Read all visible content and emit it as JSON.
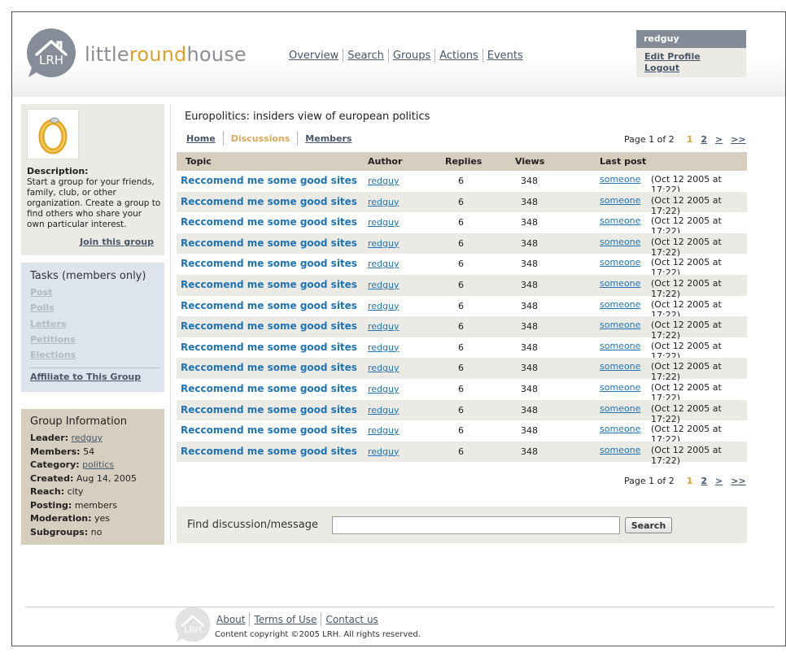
{
  "brand": {
    "logo_initials": "LRH",
    "name_part1": "little",
    "name_part2": "round",
    "name_part3": "house"
  },
  "topnav": [
    "Overview",
    "Search",
    "Groups",
    "Actions",
    "Events"
  ],
  "user": {
    "name": "redguy",
    "edit_profile": "Edit Profile",
    "logout": "Logout"
  },
  "group": {
    "title": "Europolitics: insiders view of european politics",
    "description_label": "Description:",
    "description": "Start a group for your friends, family, club, or other organization. Create a group to find others who share your own particular interest.",
    "join": "Join this group"
  },
  "tasks": {
    "title": "Tasks",
    "subtitle": "(members only)",
    "items": [
      "Post",
      "Polls",
      "Letters",
      "Petitions",
      "Elections"
    ],
    "affiliate": "Affiliate to This Group"
  },
  "info": {
    "title": "Group Information",
    "rows": [
      {
        "label": "Leader:",
        "value": "redguy",
        "link": true
      },
      {
        "label": "Members:",
        "value": "54",
        "link": false
      },
      {
        "label": "Category:",
        "value": "politics",
        "link": true
      },
      {
        "label": "Created:",
        "value": "Aug 14, 2005",
        "link": false
      },
      {
        "label": "Reach:",
        "value": "city",
        "link": false
      },
      {
        "label": "Posting:",
        "value": "members",
        "link": false
      },
      {
        "label": "Moderation:",
        "value": "yes",
        "link": false
      },
      {
        "label": "Subgroups:",
        "value": "no",
        "link": false
      }
    ]
  },
  "subnav": [
    "Home",
    "Discussions",
    "Members"
  ],
  "pager": {
    "label": "Page 1 of 2",
    "pages": [
      "1",
      "2"
    ],
    "next": ">",
    "last": ">>"
  },
  "table": {
    "headers": [
      "Topic",
      "Author",
      "Replies",
      "Views",
      "Last post"
    ],
    "rows": [
      {
        "topic": "Reccomend me some good sites",
        "author": "redguy",
        "replies": "6",
        "views": "348",
        "last_user": "someone",
        "last_date": "(Oct 12 2005 at 17:22)"
      },
      {
        "topic": "Reccomend me some good sites",
        "author": "redguy",
        "replies": "6",
        "views": "348",
        "last_user": "someone",
        "last_date": "(Oct 12 2005 at 17:22)"
      },
      {
        "topic": "Reccomend me some good sites",
        "author": "redguy",
        "replies": "6",
        "views": "348",
        "last_user": "someone",
        "last_date": "(Oct 12 2005 at 17:22)"
      },
      {
        "topic": "Reccomend me some good sites",
        "author": "redguy",
        "replies": "6",
        "views": "348",
        "last_user": "someone",
        "last_date": "(Oct 12 2005 at 17:22)"
      },
      {
        "topic": "Reccomend me some good sites",
        "author": "redguy",
        "replies": "6",
        "views": "348",
        "last_user": "someone",
        "last_date": "(Oct 12 2005 at 17:22)"
      },
      {
        "topic": "Reccomend me some good sites",
        "author": "redguy",
        "replies": "6",
        "views": "348",
        "last_user": "someone",
        "last_date": "(Oct 12 2005 at 17:22)"
      },
      {
        "topic": "Reccomend me some good sites",
        "author": "redguy",
        "replies": "6",
        "views": "348",
        "last_user": "someone",
        "last_date": "(Oct 12 2005 at 17:22)"
      },
      {
        "topic": "Reccomend me some good sites",
        "author": "redguy",
        "replies": "6",
        "views": "348",
        "last_user": "someone",
        "last_date": "(Oct 12 2005 at 17:22)"
      },
      {
        "topic": "Reccomend me some good sites",
        "author": "redguy",
        "replies": "6",
        "views": "348",
        "last_user": "someone",
        "last_date": "(Oct 12 2005 at 17:22)"
      },
      {
        "topic": "Reccomend me some good sites",
        "author": "redguy",
        "replies": "6",
        "views": "348",
        "last_user": "someone",
        "last_date": "(Oct 12 2005 at 17:22)"
      },
      {
        "topic": "Reccomend me some good sites",
        "author": "redguy",
        "replies": "6",
        "views": "348",
        "last_user": "someone",
        "last_date": "(Oct 12 2005 at 17:22)"
      },
      {
        "topic": "Reccomend me some good sites",
        "author": "redguy",
        "replies": "6",
        "views": "348",
        "last_user": "someone",
        "last_date": "(Oct 12 2005 at 17:22)"
      },
      {
        "topic": "Reccomend me some good sites",
        "author": "redguy",
        "replies": "6",
        "views": "348",
        "last_user": "someone",
        "last_date": "(Oct 12 2005 at 17:22)"
      },
      {
        "topic": "Reccomend me some good sites",
        "author": "redguy",
        "replies": "6",
        "views": "348",
        "last_user": "someone",
        "last_date": "(Oct 12 2005 at 17:22)"
      }
    ]
  },
  "find": {
    "label": "Find discussion/message",
    "value": "",
    "button": "Search"
  },
  "footer": {
    "links": [
      "About",
      "Terms of Use",
      "Contact us"
    ],
    "copyright": "Content copyright ©2005 LRH. All rights reserved."
  },
  "colors": {
    "accent": "#e0a02a",
    "link": "#1f74b8",
    "nav": "#48566a",
    "tan": "#d6cebf",
    "blue_panel": "#dde4ed",
    "beige": "#eceae5"
  },
  "icons": {
    "logo": "house-bubble-icon",
    "group": "ring-icon"
  }
}
